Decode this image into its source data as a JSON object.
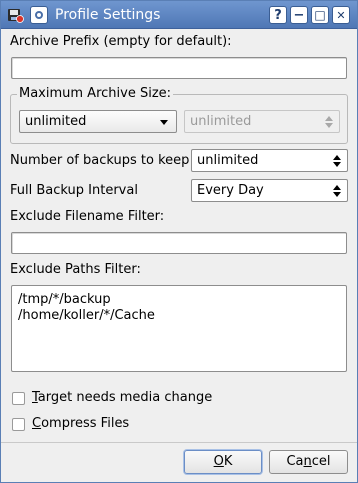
{
  "window": {
    "title": "Profile Settings",
    "help_label": "?",
    "minimize_label": "−",
    "maximize_label": "□",
    "close_label": "✕"
  },
  "archive_prefix": {
    "label": "Archive Prefix (empty for default):",
    "value": ""
  },
  "max_archive_size": {
    "group_label": "Maximum Archive Size:",
    "combo_value": "unlimited",
    "spin_value": "unlimited"
  },
  "num_backups": {
    "label": "Number of backups to keep",
    "value": "unlimited"
  },
  "full_backup_interval": {
    "label": "Full Backup Interval",
    "value": "Every Day"
  },
  "exclude_filename": {
    "label": "Exclude Filename Filter:",
    "value": ""
  },
  "exclude_paths": {
    "label": "Exclude Paths Filter:",
    "lines": [
      "/tmp/*/backup",
      "/home/koller/*/Cache"
    ]
  },
  "options": {
    "target_media_change": {
      "mnemonic": "T",
      "rest": "arget needs media change",
      "checked": false
    },
    "compress_files": {
      "mnemonic": "C",
      "rest": "ompress Files",
      "checked": false
    }
  },
  "buttons": {
    "ok": {
      "mnemonic": "O",
      "rest": "K"
    },
    "cancel": {
      "pre": "Ca",
      "mnemonic": "n",
      "rest": "cel"
    }
  },
  "colors": {
    "titlebar": "#5a80bd",
    "window_bg": "#efefef"
  }
}
